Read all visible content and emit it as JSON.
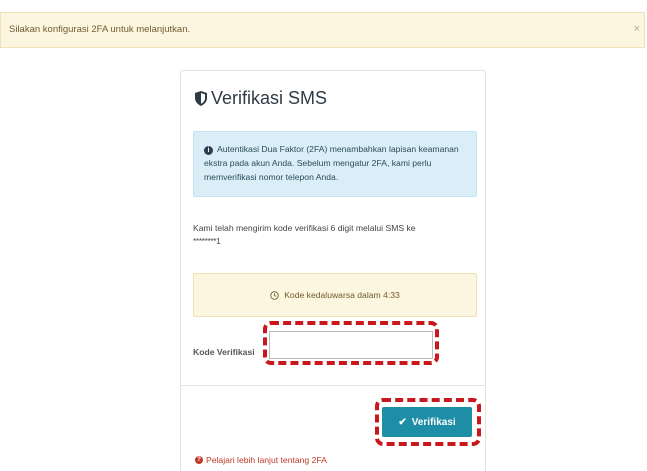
{
  "alert": {
    "message": "Silakan konfigurasi 2FA untuk melanjutkan.",
    "close_label": "×"
  },
  "card": {
    "title": "Verifikasi SMS",
    "info": "Autentikasi Dua Faktor (2FA) menambahkan lapisan keamanan ekstra pada akun Anda. Sebelum mengatur 2FA, kami perlu memverifikasi nomor telepon Anda.",
    "sent_message": "Kami telah mengirim kode verifikasi 6 digit melalui SMS ke",
    "masked_number": "********1",
    "expiry_text": "Kode kedaluwarsa dalam 4:33",
    "code_label": "Kode Verifikasi",
    "code_value": "",
    "verify_label": "Verifikasi",
    "learn_more": "Pelajari lebih lanjut tentang 2FA"
  },
  "colors": {
    "accent": "#1d8ea6",
    "highlight": "#c8171d",
    "warning_bg": "#fcf5df",
    "info_bg": "#d9eef7",
    "link": "#c0392b"
  },
  "icons": {
    "title": "shield-icon",
    "info": "info-icon",
    "expiry": "clock-icon",
    "verify": "check-icon",
    "learn_more": "question-circle-icon"
  }
}
